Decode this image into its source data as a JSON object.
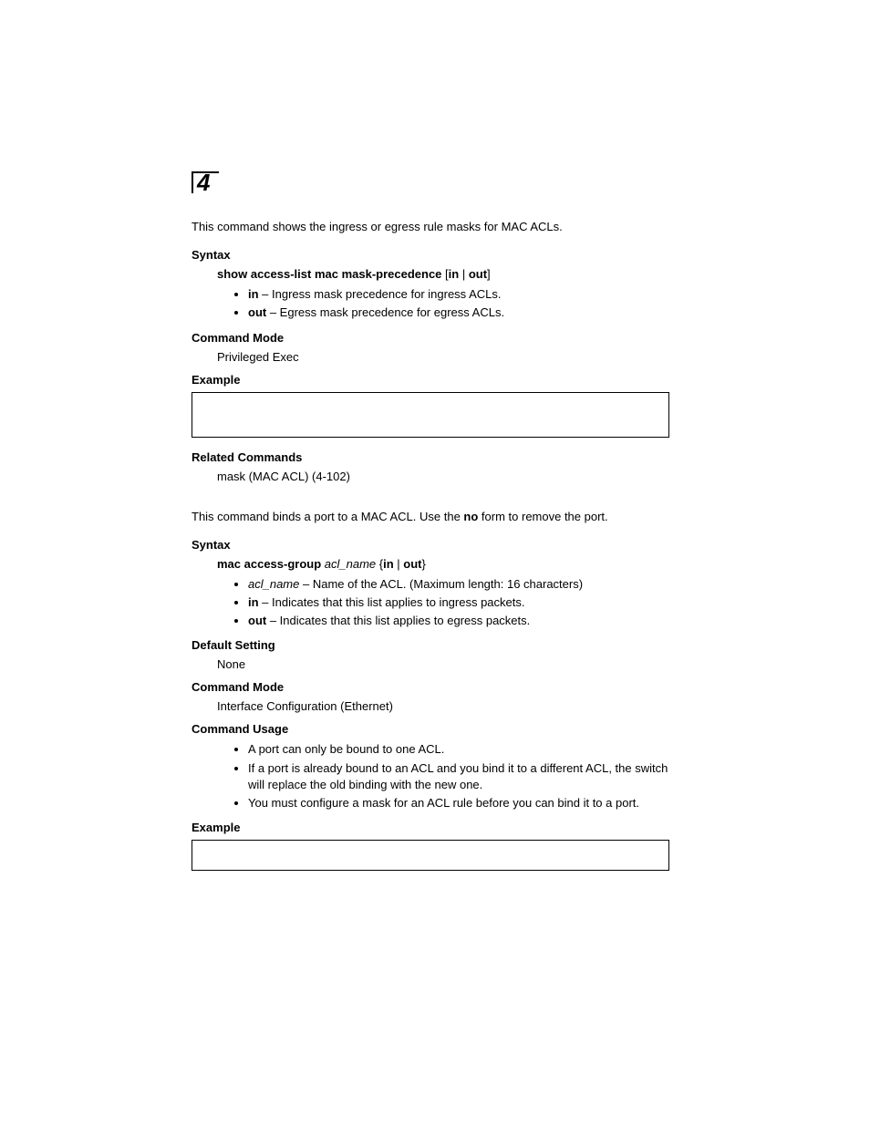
{
  "chapter_number": "4",
  "s1": {
    "intro": "This command shows the ingress or egress rule masks for MAC ACLs.",
    "syntax_h": "Syntax",
    "syntax_cmd_b": "show access-list mac mask-precedence",
    "syntax_cmd_tail": " [",
    "syntax_in": "in",
    "syntax_pipe": " | ",
    "syntax_out": "out",
    "syntax_close": "]",
    "bullets": {
      "in_b": "in",
      "in_rest": " – Ingress mask precedence for ingress ACLs.",
      "out_b": "out",
      "out_rest": " – Egress mask precedence for egress ACLs."
    },
    "cmdmode_h": "Command Mode",
    "cmdmode_v": "Privileged Exec",
    "example_h": "Example",
    "related_h": "Related Commands",
    "related_v": "mask (MAC ACL) (4-102)"
  },
  "s2": {
    "intro_a": "This command binds a port to a MAC ACL. Use the ",
    "intro_no": "no",
    "intro_b": " form to remove the port.",
    "syntax_h": "Syntax",
    "syntax_cmd_b": "mac access-group",
    "syntax_arg": " acl_name",
    "syntax_open": " {",
    "syntax_in": "in",
    "syntax_pipe": " | ",
    "syntax_out": "out",
    "syntax_close": "}",
    "bullets": {
      "acl_i": "acl_name",
      "acl_rest": " – Name of the ACL. (Maximum length: 16 characters)",
      "in_b": "in",
      "in_rest": " – Indicates that this list applies to ingress packets.",
      "out_b": "out",
      "out_rest": " – Indicates that this list applies to egress packets."
    },
    "default_h": "Default Setting",
    "default_v": "None",
    "cmdmode_h": "Command Mode",
    "cmdmode_v": "Interface Configuration (Ethernet)",
    "usage_h": "Command Usage",
    "usage": {
      "u1": "A port can only be bound to one ACL.",
      "u2": "If a port is already bound to an ACL and you bind it to a different ACL, the switch will replace the old binding with the new one.",
      "u3": "You must configure a mask for an ACL rule before you can bind it to a port."
    },
    "example_h": "Example"
  }
}
